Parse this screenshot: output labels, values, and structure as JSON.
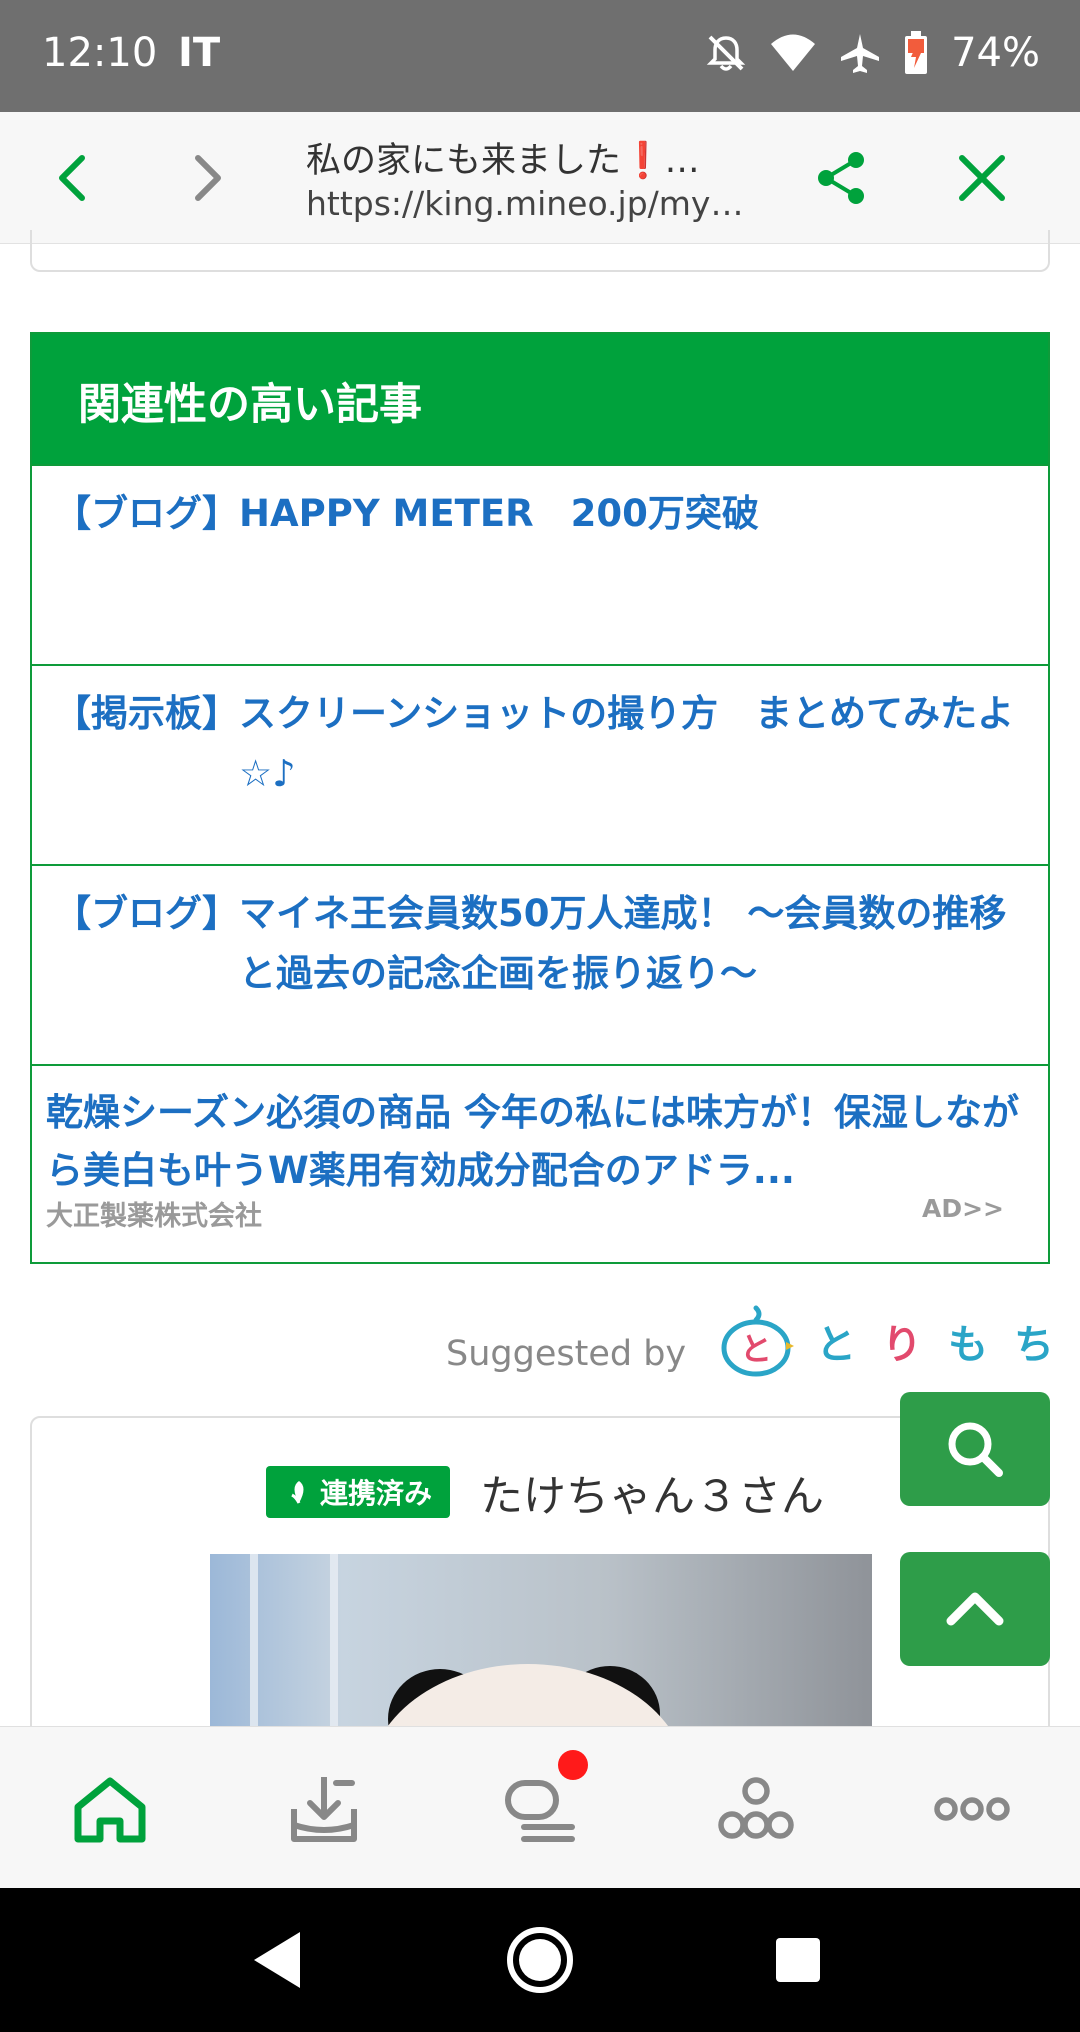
{
  "status_bar": {
    "time": "12:10",
    "carrier": "IT",
    "battery": "74%",
    "icons": [
      "notifications-off-icon",
      "wifi-icon",
      "airplane-icon",
      "battery-charging-icon"
    ]
  },
  "browser": {
    "title": "私の家にも来ました❗…",
    "url": "https://king.mineo.jp/my…",
    "icons": [
      "back-icon",
      "forward-icon",
      "share-icon",
      "close-icon"
    ]
  },
  "related": {
    "heading": "関連性の高い記事",
    "items": [
      {
        "category": "【ブログ】",
        "title": "HAPPY METER　200万突破"
      },
      {
        "category": "【掲示板】",
        "title": "スクリーンショットの撮り方　まとめてみたよ☆♪"
      },
      {
        "category": "【ブログ】",
        "title": "マイネ王会員数50万人達成！ ～会員数の推移と過去の記念企画を振り返り～"
      }
    ],
    "ad": {
      "text": "乾燥シーズン必須の商品 今年の私には味方が！保湿しながら美白も叶うW薬用有効成分配合のアドラ...",
      "sponsor": "大正製薬株式会社",
      "label": "AD>>"
    }
  },
  "suggested": {
    "prefix": "Suggested by",
    "logo_chars": [
      "と",
      "り",
      "も",
      "ち"
    ],
    "logo_mark": "と"
  },
  "post": {
    "badge": "連携済み",
    "author": "たけちゃん３さん"
  },
  "fab": {
    "search_icon": "search-icon",
    "top_icon": "chevron-up-icon"
  },
  "bottom_nav": {
    "items": [
      "home-icon",
      "upload-icon",
      "chat-icon",
      "community-icon",
      "more-icon"
    ]
  },
  "colors": {
    "brand_green": "#00a23c",
    "link_blue": "#1c6fc2",
    "fab_green": "#2e9d49",
    "notify_red": "#ff1a1a"
  }
}
